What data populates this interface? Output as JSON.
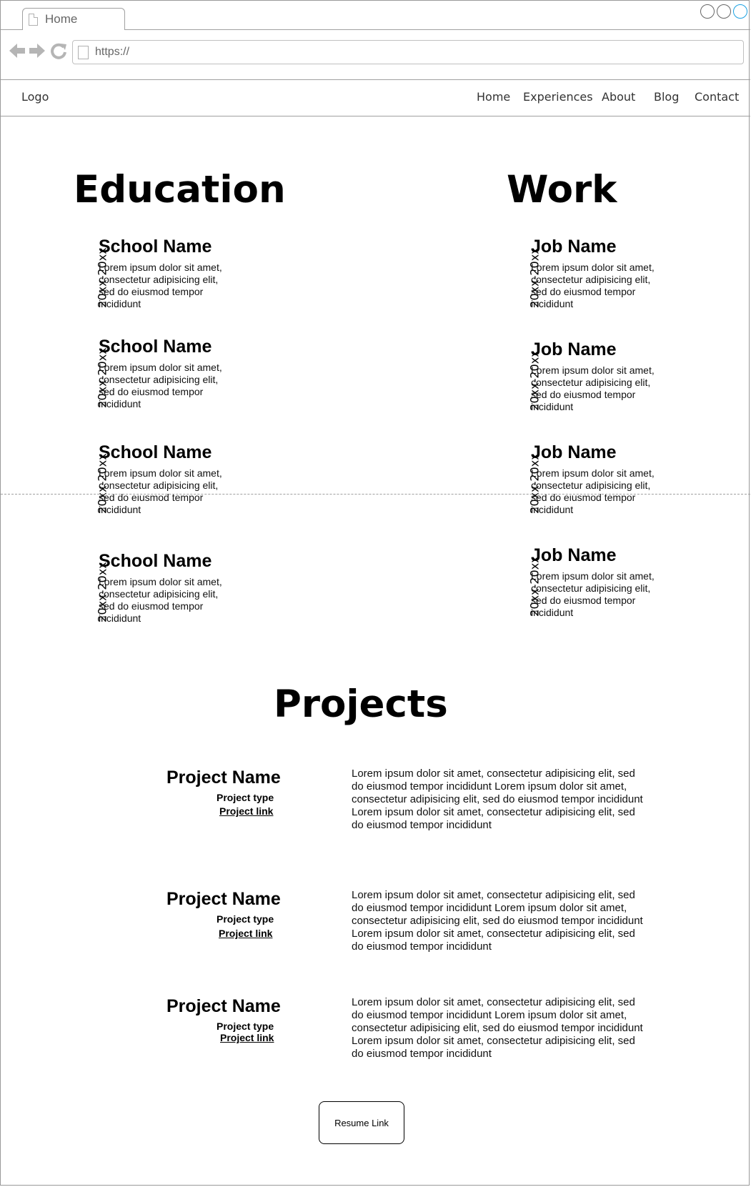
{
  "browser": {
    "tab_label": "Home",
    "url": "https://",
    "icons": [
      "back-arrow-icon",
      "forward-arrow-icon",
      "reload-icon",
      "page-icon"
    ]
  },
  "nav": {
    "logo": "Logo",
    "items": [
      "Home",
      "Experiences",
      "About",
      "Blog",
      "Contact"
    ]
  },
  "education": {
    "heading": "Education",
    "entries": [
      {
        "date": "20xx-20xx",
        "title": "School Name",
        "desc": "Lorem ipsum dolor sit amet, consectetur adipisicing elit, sed do eiusmod tempor incididunt"
      },
      {
        "date": "20xx-20xx",
        "title": "School Name",
        "desc": "Lorem ipsum dolor sit amet, consectetur adipisicing elit, sed do eiusmod tempor incididunt"
      },
      {
        "date": "20xx-20xx",
        "title": "School Name",
        "desc": "Lorem ipsum dolor sit amet, consectetur adipisicing elit, sed do eiusmod tempor incididunt"
      },
      {
        "date": "20xx-20xx",
        "title": "School Name",
        "desc": "Lorem ipsum dolor sit amet, consectetur adipisicing elit, sed do eiusmod tempor incididunt"
      }
    ]
  },
  "work": {
    "heading": "Work",
    "entries": [
      {
        "date": "20xx-20xx",
        "title": "Job Name",
        "desc": "Lorem ipsum dolor sit amet, consectetur adipisicing elit, sed do eiusmod tempor incididunt"
      },
      {
        "date": "20xx-20xx",
        "title": "Job Name",
        "desc": "Lorem ipsum dolor sit amet, consectetur adipisicing elit, sed do eiusmod tempor incididunt"
      },
      {
        "date": "20xx-20xx",
        "title": "Job Name",
        "desc": "Lorem ipsum dolor sit amet, consectetur adipisicing elit, sed do eiusmod tempor incididunt"
      },
      {
        "date": "20xx-20xx",
        "title": "Job Name",
        "desc": "Lorem ipsum dolor sit amet, consectetur adipisicing elit, sed do eiusmod tempor incididunt"
      }
    ]
  },
  "projects": {
    "heading": "Projects",
    "items": [
      {
        "name": "Project Name",
        "type": "Project type",
        "link": "Project link",
        "desc": "Lorem ipsum dolor sit amet, consectetur adipisicing elit, sed do eiusmod tempor incididunt Lorem ipsum dolor sit amet, consectetur adipisicing elit, sed do eiusmod tempor incididunt Lorem ipsum dolor sit amet, consectetur adipisicing elit, sed do eiusmod tempor incididunt"
      },
      {
        "name": "Project Name",
        "type": "Project type",
        "link": "Project link",
        "desc": "Lorem ipsum dolor sit amet, consectetur adipisicing elit, sed do eiusmod tempor incididunt Lorem ipsum dolor sit amet, consectetur adipisicing elit, sed do eiusmod tempor incididunt Lorem ipsum dolor sit amet, consectetur adipisicing elit, sed do eiusmod tempor incididunt"
      },
      {
        "name": "Project Name",
        "type": "Project type",
        "link": "Project link",
        "desc": "Lorem ipsum dolor sit amet, consectetur adipisicing elit, sed do eiusmod tempor incididunt Lorem ipsum dolor sit amet, consectetur adipisicing elit, sed do eiusmod tempor incididunt Lorem ipsum dolor sit amet, consectetur adipisicing elit, sed do eiusmod tempor incididunt"
      }
    ]
  },
  "resume_label": "Resume Link",
  "colors": {
    "border": "#a0a0a0",
    "accent": "#1ba1e2",
    "text": "#000000"
  }
}
